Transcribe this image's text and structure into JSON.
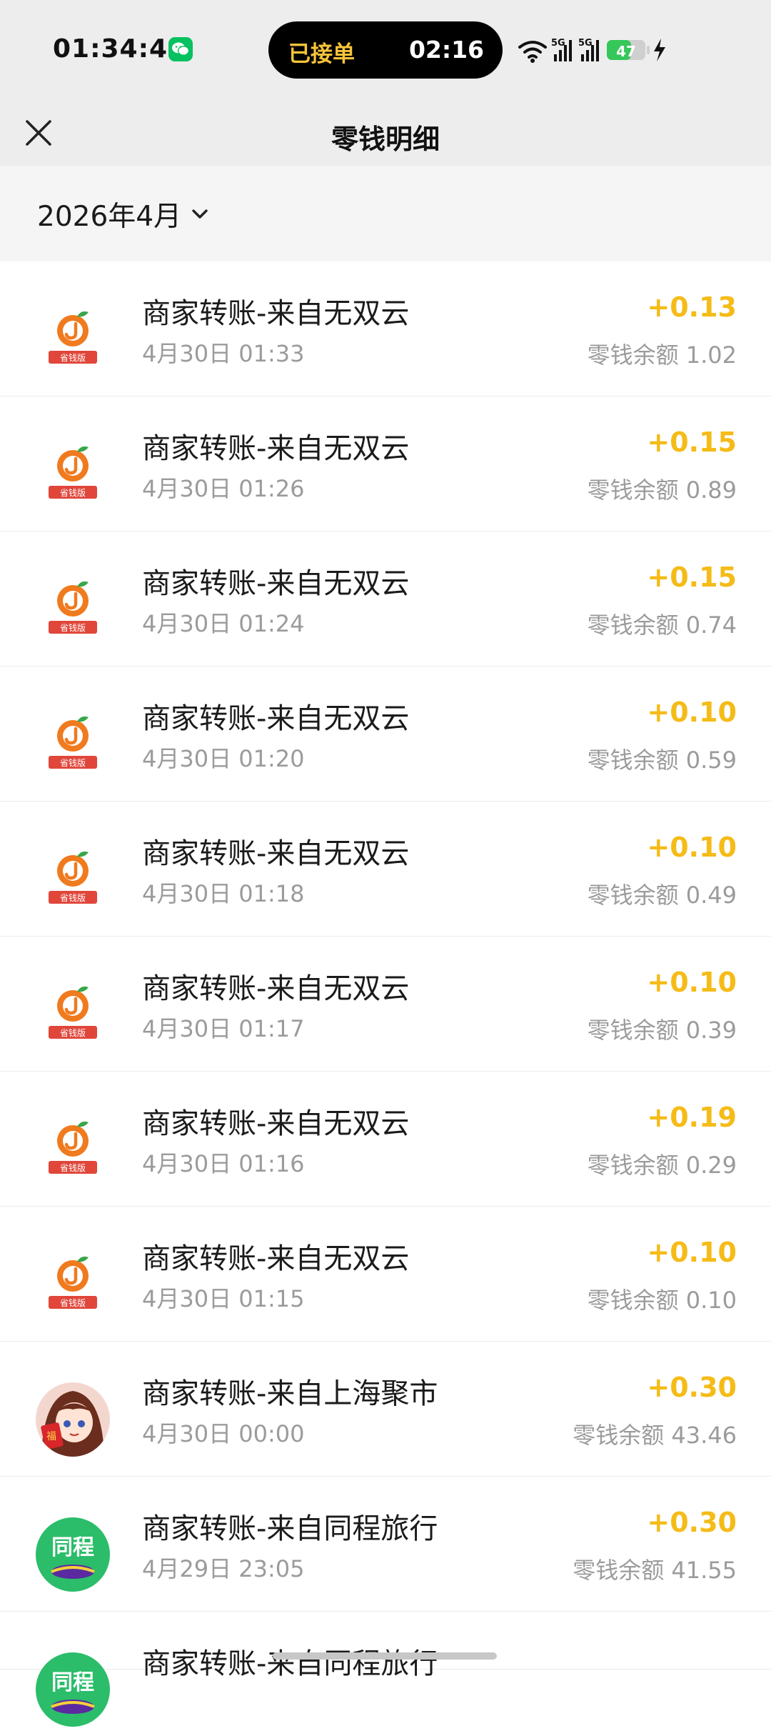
{
  "status_bar": {
    "time": "01:34:46",
    "island_left": "已接单",
    "island_right": "02:16",
    "battery": "47",
    "network_1": "5G",
    "network_2": "5G"
  },
  "nav": {
    "title": "零钱明细"
  },
  "filter": {
    "month": "2026年4月"
  },
  "transactions": [
    {
      "title": "商家转账-来自无双云",
      "time": "4月30日 01:33",
      "amount": "+0.13",
      "balance": "零钱余额 1.02",
      "icon": "orange-app-icon"
    },
    {
      "title": "商家转账-来自无双云",
      "time": "4月30日 01:26",
      "amount": "+0.15",
      "balance": "零钱余额 0.89",
      "icon": "orange-app-icon"
    },
    {
      "title": "商家转账-来自无双云",
      "time": "4月30日 01:24",
      "amount": "+0.15",
      "balance": "零钱余额 0.74",
      "icon": "orange-app-icon"
    },
    {
      "title": "商家转账-来自无双云",
      "time": "4月30日 01:20",
      "amount": "+0.10",
      "balance": "零钱余额 0.59",
      "icon": "orange-app-icon"
    },
    {
      "title": "商家转账-来自无双云",
      "time": "4月30日 01:18",
      "amount": "+0.10",
      "balance": "零钱余额 0.49",
      "icon": "orange-app-icon"
    },
    {
      "title": "商家转账-来自无双云",
      "time": "4月30日 01:17",
      "amount": "+0.10",
      "balance": "零钱余额 0.39",
      "icon": "orange-app-icon"
    },
    {
      "title": "商家转账-来自无双云",
      "time": "4月30日 01:16",
      "amount": "+0.19",
      "balance": "零钱余额 0.29",
      "icon": "orange-app-icon"
    },
    {
      "title": "商家转账-来自无双云",
      "time": "4月30日 01:15",
      "amount": "+0.10",
      "balance": "零钱余额 0.10",
      "icon": "orange-app-icon"
    },
    {
      "title": "商家转账-来自上海聚市",
      "time": "4月30日 00:00",
      "amount": "+0.30",
      "balance": "零钱余额 43.46",
      "icon": "anime-avatar-icon"
    },
    {
      "title": "商家转账-来自同程旅行",
      "time": "4月29日 23:05",
      "amount": "+0.30",
      "balance": "零钱余额 41.55",
      "icon": "tongcheng-icon"
    },
    {
      "title": "商家转账-来自同程旅行",
      "time": "",
      "amount": "",
      "balance": "",
      "icon": "tongcheng-icon"
    }
  ],
  "icon_labels": {
    "orange_badge": "省钱版",
    "tongcheng": "同程",
    "fu": "福"
  },
  "colors": {
    "amount": "#f5bb17",
    "island_text": "#f6c33a",
    "wechat": "#07c160"
  }
}
